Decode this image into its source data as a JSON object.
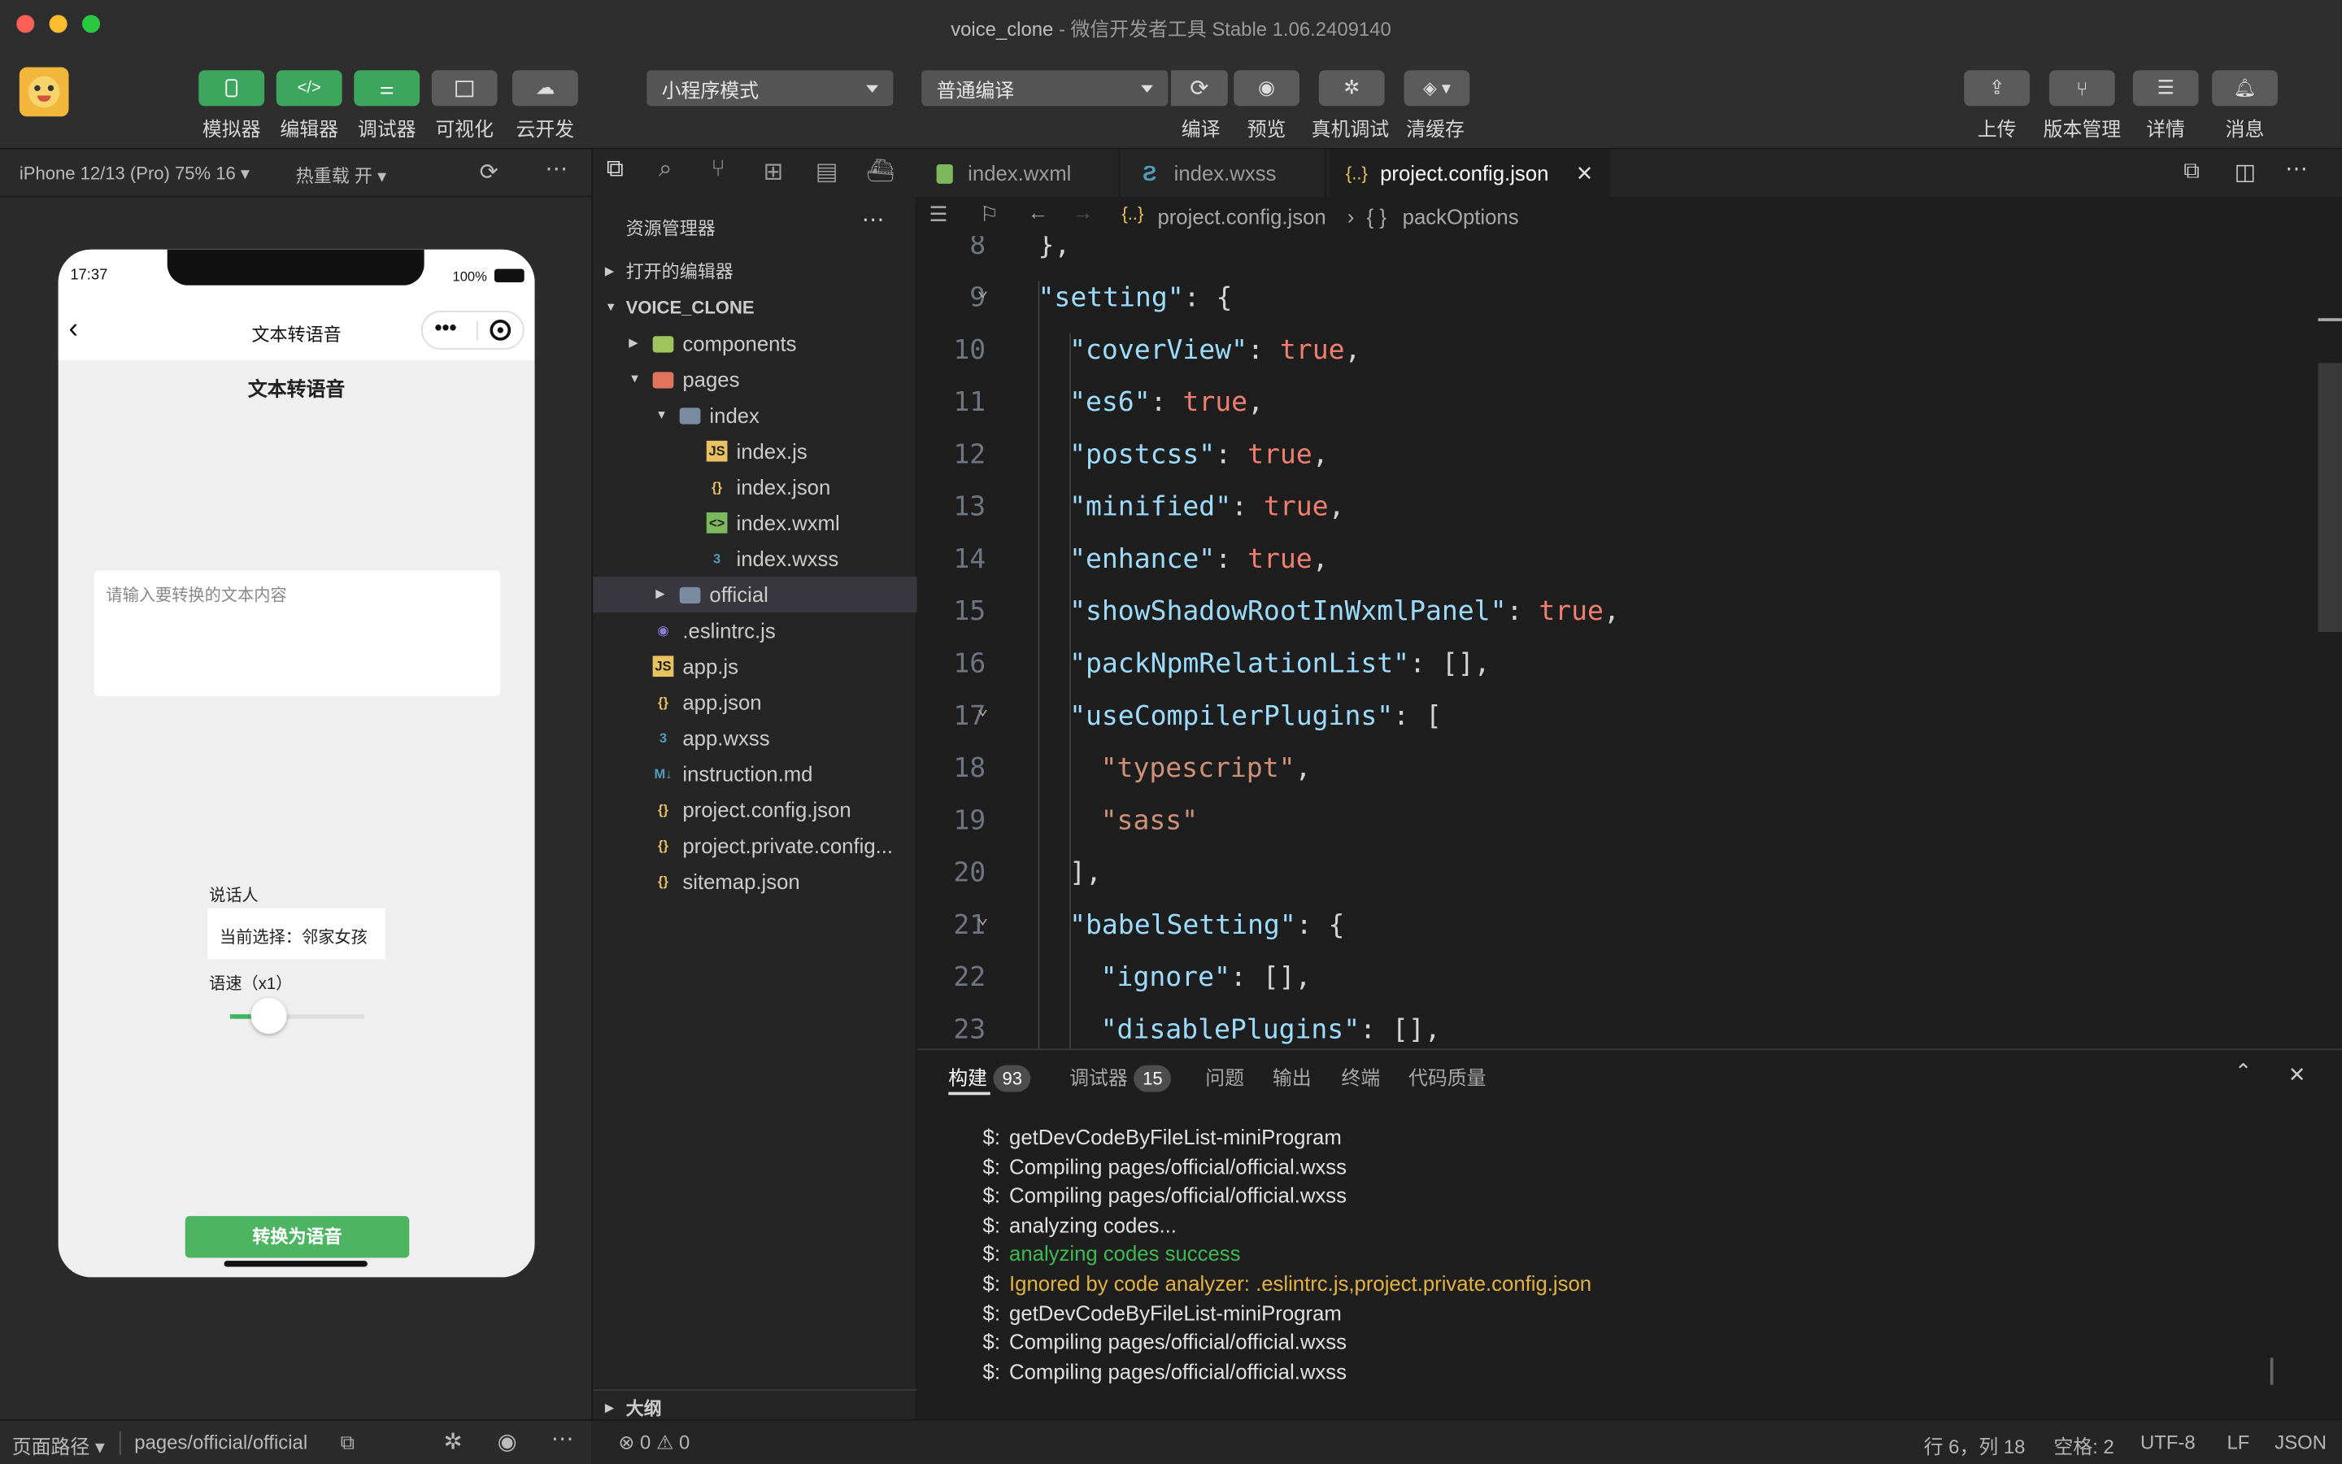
{
  "window": {
    "title_left": "voice_clone",
    "title_right": "- 微信开发者工具 Stable 1.06.2409140"
  },
  "toolbar": {
    "left_buttons": [
      {
        "label": "模拟器"
      },
      {
        "label": "编辑器"
      },
      {
        "label": "调试器"
      },
      {
        "label": "可视化"
      },
      {
        "label": "云开发"
      }
    ],
    "mode_select": "小程序模式",
    "compile_select": "普通编译",
    "mid_buttons": [
      {
        "label": "编译"
      },
      {
        "label": "预览"
      },
      {
        "label": "真机调试"
      },
      {
        "label": "清缓存"
      }
    ],
    "right_buttons": [
      {
        "label": "上传"
      },
      {
        "label": "版本管理"
      },
      {
        "label": "详情"
      },
      {
        "label": "消息"
      }
    ]
  },
  "simulator": {
    "device": "iPhone 12/13 (Pro) 75% 16",
    "hot_reload": "热重载 开",
    "phone": {
      "time": "17:37",
      "battery": "100%",
      "nav_title": "文本转语音",
      "heading": "文本转语音",
      "textarea_placeholder": "请输入要转换的文本内容",
      "speaker_label": "说话人",
      "speaker_current": "当前选择：邻家女孩",
      "speed_label": "语速（x1）",
      "speed_fraction": 0.2,
      "convert_button": "转换为语音"
    },
    "footer": {
      "path_label": "页面路径",
      "path": "pages/official/official"
    }
  },
  "explorer": {
    "title": "资源管理器",
    "open_editors": "打开的编辑器",
    "root": "VOICE_CLONE",
    "items": [
      {
        "label": "components",
        "icon": "folder-icon"
      },
      {
        "label": "pages",
        "icon": "folder-open-icon"
      },
      {
        "label": "index",
        "icon": "folder-open-icon"
      },
      {
        "label": "index.js",
        "icon": "js-icon"
      },
      {
        "label": "index.json",
        "icon": "json-icon"
      },
      {
        "label": "index.wxml",
        "icon": "wxml-icon"
      },
      {
        "label": "index.wxss",
        "icon": "wxss-icon"
      },
      {
        "label": "official",
        "icon": "folder-icon"
      },
      {
        "label": ".eslintrc.js",
        "icon": "eslint-icon"
      },
      {
        "label": "app.js",
        "icon": "js-icon"
      },
      {
        "label": "app.json",
        "icon": "json-icon"
      },
      {
        "label": "app.wxss",
        "icon": "wxss-icon"
      },
      {
        "label": "instruction.md",
        "icon": "markdown-icon"
      },
      {
        "label": "project.config.json",
        "icon": "json-icon"
      },
      {
        "label": "project.private.config...",
        "icon": "json-icon"
      },
      {
        "label": "sitemap.json",
        "icon": "json-icon"
      }
    ],
    "outline": "大纲"
  },
  "editor": {
    "tabs": [
      {
        "label": "index.wxml"
      },
      {
        "label": "index.wxss"
      },
      {
        "label": "project.config.json"
      }
    ],
    "breadcrumb": {
      "file": "project.config.json",
      "symbol": "packOptions"
    },
    "lines": [
      {
        "n": "8",
        "parts": [
          [
            "p",
            "},"
          ]
        ]
      },
      {
        "n": "9",
        "parts": [
          [
            "k",
            "\"setting\""
          ],
          [
            "p",
            ": {"
          ]
        ]
      },
      {
        "n": "10",
        "parts": [
          [
            "k",
            "\"coverView\""
          ],
          [
            "p",
            ": "
          ],
          [
            "t",
            "true"
          ],
          [
            "p",
            ","
          ]
        ]
      },
      {
        "n": "11",
        "parts": [
          [
            "k",
            "\"es6\""
          ],
          [
            "p",
            ": "
          ],
          [
            "t",
            "true"
          ],
          [
            "p",
            ","
          ]
        ]
      },
      {
        "n": "12",
        "parts": [
          [
            "k",
            "\"postcss\""
          ],
          [
            "p",
            ": "
          ],
          [
            "t",
            "true"
          ],
          [
            "p",
            ","
          ]
        ]
      },
      {
        "n": "13",
        "parts": [
          [
            "k",
            "\"minified\""
          ],
          [
            "p",
            ": "
          ],
          [
            "t",
            "true"
          ],
          [
            "p",
            ","
          ]
        ]
      },
      {
        "n": "14",
        "parts": [
          [
            "k",
            "\"enhance\""
          ],
          [
            "p",
            ": "
          ],
          [
            "t",
            "true"
          ],
          [
            "p",
            ","
          ]
        ]
      },
      {
        "n": "15",
        "parts": [
          [
            "k",
            "\"showShadowRootInWxmlPanel\""
          ],
          [
            "p",
            ": "
          ],
          [
            "t",
            "true"
          ],
          [
            "p",
            ","
          ]
        ]
      },
      {
        "n": "16",
        "parts": [
          [
            "k",
            "\"packNpmRelationList\""
          ],
          [
            "p",
            ": [],"
          ]
        ]
      },
      {
        "n": "17",
        "parts": [
          [
            "k",
            "\"useCompilerPlugins\""
          ],
          [
            "p",
            ": ["
          ]
        ]
      },
      {
        "n": "18",
        "parts": [
          [
            "s",
            "\"typescript\""
          ],
          [
            "p",
            ","
          ]
        ]
      },
      {
        "n": "19",
        "parts": [
          [
            "s",
            "\"sass\""
          ]
        ]
      },
      {
        "n": "20",
        "parts": [
          [
            "p",
            "],"
          ]
        ]
      },
      {
        "n": "21",
        "parts": [
          [
            "k",
            "\"babelSetting\""
          ],
          [
            "p",
            ": {"
          ]
        ]
      },
      {
        "n": "22",
        "parts": [
          [
            "k",
            "\"ignore\""
          ],
          [
            "p",
            ": [],"
          ]
        ]
      },
      {
        "n": "23",
        "parts": [
          [
            "k",
            "\"disablePlugins\""
          ],
          [
            "p",
            ": [],"
          ]
        ]
      }
    ]
  },
  "panel": {
    "tabs": [
      {
        "label": "构建",
        "badge": "93"
      },
      {
        "label": "调试器",
        "badge": "15"
      },
      {
        "label": "问题"
      },
      {
        "label": "输出"
      },
      {
        "label": "终端"
      },
      {
        "label": "代码质量"
      }
    ],
    "log": [
      {
        "text": "getDevCodeByFileList-miniProgram",
        "color": "#e1e1e1"
      },
      {
        "text": "Compiling pages/official/official.wxss",
        "color": "#e1e1e1"
      },
      {
        "text": "Compiling pages/official/official.wxss",
        "color": "#e1e1e1"
      },
      {
        "text": "analyzing codes...",
        "color": "#e1e1e1"
      },
      {
        "text": "analyzing codes success",
        "color": "#3fb950"
      },
      {
        "text": "Ignored by code analyzer: .eslintrc.js,project.private.config.json",
        "color": "#e3b341"
      },
      {
        "text": "getDevCodeByFileList-miniProgram",
        "color": "#e1e1e1"
      },
      {
        "text": "Compiling pages/official/official.wxss",
        "color": "#e1e1e1"
      },
      {
        "text": "Compiling pages/official/official.wxss",
        "color": "#e1e1e1"
      }
    ],
    "prompt": "$:"
  },
  "status": {
    "errors": "0",
    "warnings": "0",
    "cursor": "行 6，列 18",
    "spaces": "空格: 2",
    "encoding": "UTF-8",
    "eol": "LF",
    "lang": "JSON"
  }
}
